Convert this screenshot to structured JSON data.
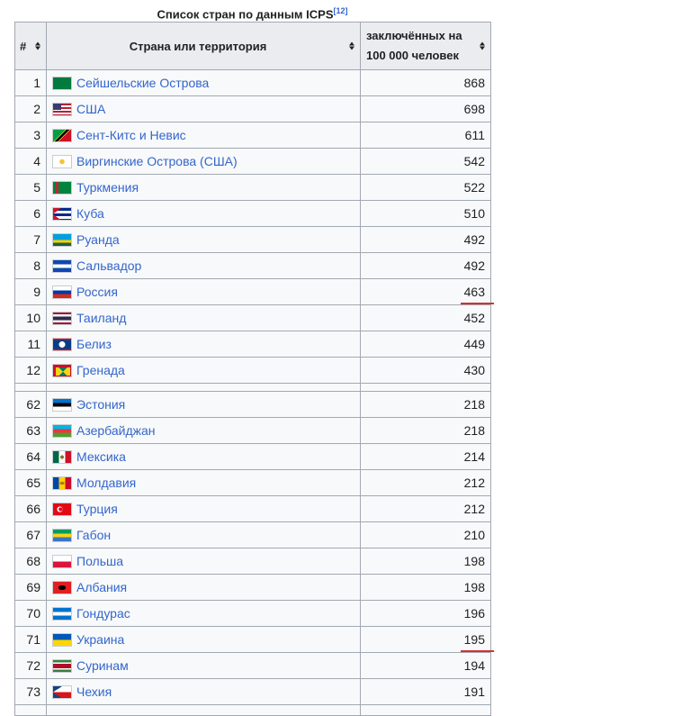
{
  "caption": {
    "title": "Список стран по данным ICPS",
    "ref": "[12]"
  },
  "headers": {
    "num": "#",
    "country": "Страна или территория",
    "value_line1": "заключённых на",
    "value_line2": "100 000 человек"
  },
  "rows_top": [
    {
      "n": "1",
      "country": "Сейшельские Острова",
      "value": "868",
      "flag": "seychelles-flag-icon"
    },
    {
      "n": "2",
      "country": "США",
      "value": "698",
      "flag": "usa-flag-icon"
    },
    {
      "n": "3",
      "country": "Сент-Китс и Невис",
      "value": "611",
      "flag": "saint-kitts-flag-icon"
    },
    {
      "n": "4",
      "country": "Виргинские Острова (США)",
      "value": "542",
      "flag": "us-virgin-islands-flag-icon"
    },
    {
      "n": "5",
      "country": "Туркмения",
      "value": "522",
      "flag": "turkmenistan-flag-icon"
    },
    {
      "n": "6",
      "country": "Куба",
      "value": "510",
      "flag": "cuba-flag-icon"
    },
    {
      "n": "7",
      "country": "Руанда",
      "value": "492",
      "flag": "rwanda-flag-icon"
    },
    {
      "n": "8",
      "country": "Сальвадор",
      "value": "492",
      "flag": "el-salvador-flag-icon"
    },
    {
      "n": "9",
      "country": "Россия",
      "value": "463",
      "flag": "russia-flag-icon",
      "highlight": true
    },
    {
      "n": "10",
      "country": "Таиланд",
      "value": "452",
      "flag": "thailand-flag-icon"
    },
    {
      "n": "11",
      "country": "Белиз",
      "value": "449",
      "flag": "belize-flag-icon"
    },
    {
      "n": "12",
      "country": "Гренада",
      "value": "430",
      "flag": "grenada-flag-icon"
    }
  ],
  "rows_bottom": [
    {
      "n": "62",
      "country": "Эстония",
      "value": "218",
      "flag": "estonia-flag-icon"
    },
    {
      "n": "63",
      "country": "Азербайджан",
      "value": "218",
      "flag": "azerbaijan-flag-icon"
    },
    {
      "n": "64",
      "country": "Мексика",
      "value": "214",
      "flag": "mexico-flag-icon"
    },
    {
      "n": "65",
      "country": "Молдавия",
      "value": "212",
      "flag": "moldova-flag-icon"
    },
    {
      "n": "66",
      "country": "Турция",
      "value": "212",
      "flag": "turkey-flag-icon"
    },
    {
      "n": "67",
      "country": "Габон",
      "value": "210",
      "flag": "gabon-flag-icon"
    },
    {
      "n": "68",
      "country": "Польша",
      "value": "198",
      "flag": "poland-flag-icon"
    },
    {
      "n": "69",
      "country": "Албания",
      "value": "198",
      "flag": "albania-flag-icon"
    },
    {
      "n": "70",
      "country": "Гондурас",
      "value": "196",
      "flag": "honduras-flag-icon"
    },
    {
      "n": "71",
      "country": "Украина",
      "value": "195",
      "flag": "ukraine-flag-icon",
      "highlight": true
    },
    {
      "n": "72",
      "country": "Суринам",
      "value": "194",
      "flag": "suriname-flag-icon"
    },
    {
      "n": "73",
      "country": "Чехия",
      "value": "191",
      "flag": "czechia-flag-icon"
    }
  ],
  "colors": {
    "link": "#3366cc",
    "header_bg": "#eaecf0",
    "cell_bg": "#f8f9fa",
    "border": "#a2a9b1",
    "highlight_underline": "#d62f2f"
  }
}
